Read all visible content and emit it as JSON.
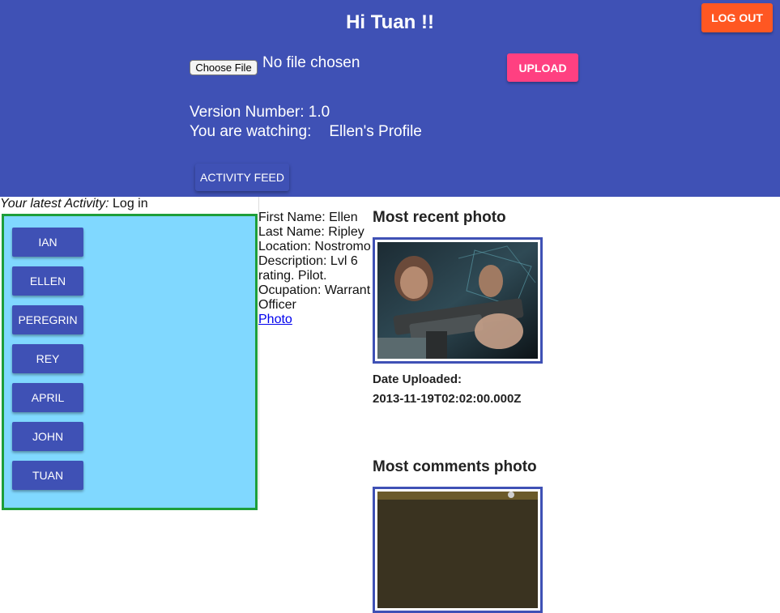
{
  "header": {
    "greeting": "Hi Tuan !!",
    "logout_label": "LOG OUT",
    "choose_file_label": "Choose File",
    "no_file_text": "No file chosen",
    "upload_label": "UPLOAD",
    "version_text": "Version Number: 1.0",
    "watching_label": "You are watching:",
    "watching_profile": "Ellen's Profile",
    "activity_feed_label": "ACTIVITY FEED"
  },
  "latest_activity": {
    "label": "Your latest Activity:",
    "value": "Log in"
  },
  "users": [
    "IAN",
    "ELLEN",
    "PEREGRIN",
    "REY",
    "APRIL",
    "JOHN",
    "TUAN"
  ],
  "profile": {
    "first_name": "First Name: Ellen",
    "last_name": "Last Name: Ripley",
    "location": "Location: Nostromo",
    "description": "Description: Lvl 6 rating. Pilot.",
    "occupation": "Ocupation: Warrant Officer",
    "photo_link": "Photo"
  },
  "recent_photo": {
    "title": "Most recent photo",
    "date_label": "Date Uploaded:",
    "date_value": "2013-11-19T02:02:00.000Z"
  },
  "comments_photo": {
    "title": "Most comments photo"
  },
  "colors": {
    "header_bg": "#3f51b5",
    "logout": "#ff5722",
    "upload": "#ff4081",
    "panel_bg": "#80d8ff",
    "panel_border": "#1e9e3a"
  }
}
